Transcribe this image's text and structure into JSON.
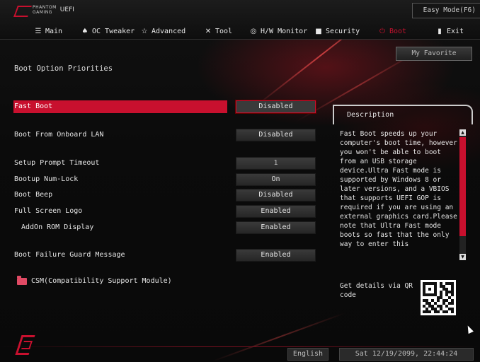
{
  "brand": {
    "logo_line1": "PHANTOM",
    "logo_line2": "GAMING",
    "product": "UEFI"
  },
  "easy_mode_label": "Easy Mode(F6)",
  "menu": [
    {
      "label": "Main",
      "icon": "list-icon"
    },
    {
      "label": "OC Tweaker",
      "icon": "flame-icon"
    },
    {
      "label": "Advanced",
      "icon": "star-icon"
    },
    {
      "label": "Tool",
      "icon": "tools-icon"
    },
    {
      "label": "H/W Monitor",
      "icon": "gauge-icon"
    },
    {
      "label": "Security",
      "icon": "shield-icon"
    },
    {
      "label": "Boot",
      "icon": "power-icon",
      "active": true
    },
    {
      "label": "Exit",
      "icon": "exit-icon"
    }
  ],
  "my_favorite_label": "My Favorite",
  "section_title": "Boot Option Priorities",
  "settings": [
    {
      "label": "Fast Boot",
      "value": "Disabled",
      "selected": true
    },
    {
      "label": "Boot From Onboard LAN",
      "value": "Disabled"
    },
    {
      "label": "Setup Prompt Timeout",
      "value": "1"
    },
    {
      "label": "Bootup Num-Lock",
      "value": "On"
    },
    {
      "label": "Boot Beep",
      "value": "Disabled"
    },
    {
      "label": "Full Screen Logo",
      "value": "Enabled"
    },
    {
      "label": "AddOn ROM Display",
      "value": "Enabled"
    },
    {
      "label": "Boot Failure Guard Message",
      "value": "Enabled"
    }
  ],
  "csm_label": "CSM(Compatibility Support Module)",
  "description": {
    "title": "Description",
    "text": "Fast Boot speeds up your computer's boot time, however you won't be able to boot from an USB storage device.Ultra Fast mode is supported by Windows 8 or later versions, and a VBIOS that supports UEFI GOP is required if you are using an external graphics card.Please note that Ultra Fast mode boots so fast that the only way to enter this"
  },
  "qr_label": "Get details via QR code",
  "language_label": "English",
  "datetime": "Sat 12/19/2099, 22:44:24",
  "colors": {
    "accent": "#c8102e",
    "background": "#0a0a0a"
  }
}
